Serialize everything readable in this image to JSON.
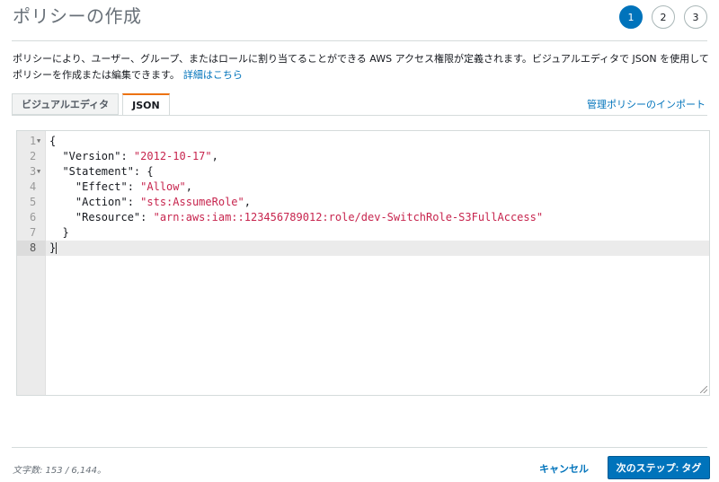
{
  "page": {
    "title": "ポリシーの作成"
  },
  "steps": [
    {
      "label": "1",
      "active": true
    },
    {
      "label": "2",
      "active": false
    },
    {
      "label": "3",
      "active": false
    }
  ],
  "description": {
    "text": "ポリシーにより、ユーザー、グループ、またはロールに割り当てることができる AWS アクセス権限が定義されます。ビジュアルエディタで JSON を使用してポリシーを作成または編集できます。",
    "link_label": "詳細はこちら"
  },
  "tabs": [
    {
      "label": "ビジュアルエディタ",
      "active": false
    },
    {
      "label": "JSON",
      "active": true
    }
  ],
  "import_link": "管理ポリシーのインポート",
  "editor": {
    "line_numbers": [
      "1",
      "2",
      "3",
      "4",
      "5",
      "6",
      "7",
      "8"
    ],
    "lines": {
      "l1": "{",
      "l2_key": "  \"Version\": ",
      "l2_val": "\"2012-10-17\"",
      "l2_end": ",",
      "l3": "  \"Statement\": {",
      "l4_key": "    \"Effect\": ",
      "l4_val": "\"Allow\"",
      "l4_end": ",",
      "l5_key": "    \"Action\": ",
      "l5_val": "\"sts:AssumeRole\"",
      "l5_end": ",",
      "l6_key": "    \"Resource\": ",
      "l6_val": "\"arn:aws:iam::123456789012:role/dev-SwitchRole-S3FullAccess\"",
      "l7": "  }",
      "l8": "}"
    }
  },
  "footer": {
    "char_count": "文字数: 153 / 6,144。",
    "cancel_label": "キャンセル",
    "next_label": "次のステップ: タグ"
  },
  "colors": {
    "accent": "#0073bb",
    "tab_highlight": "#ec7211",
    "string": "#c7254e"
  }
}
